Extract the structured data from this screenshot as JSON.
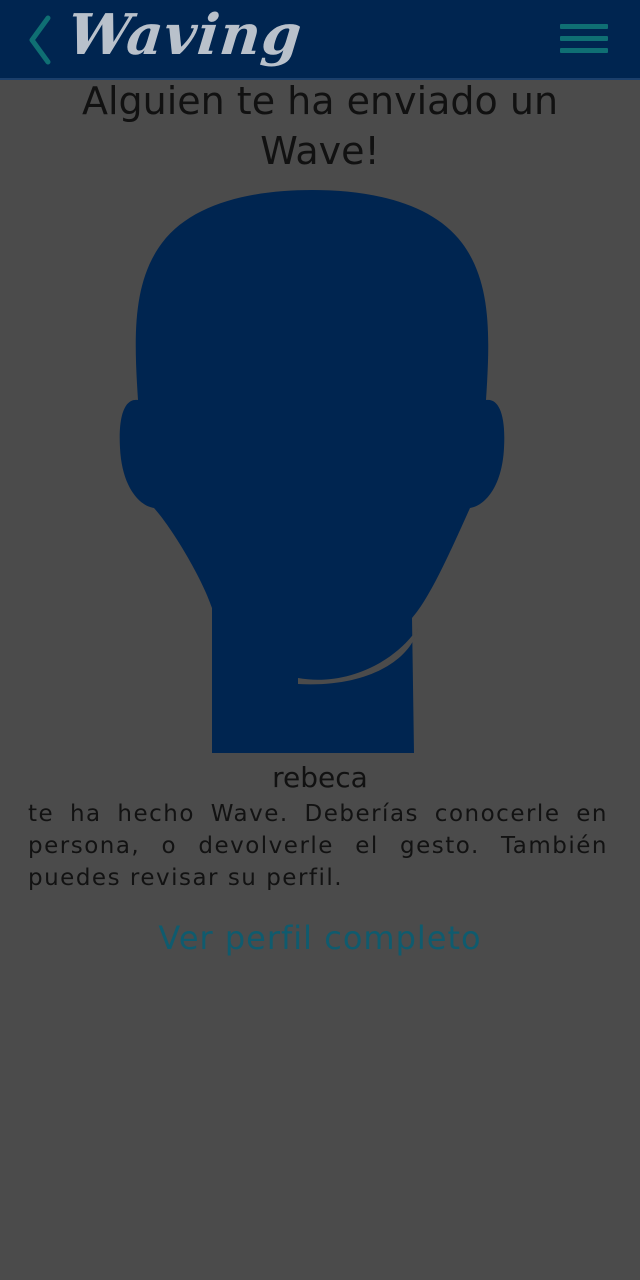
{
  "header": {
    "logo_text": "Waving",
    "back_icon": "chevron-left-icon",
    "menu_icon": "hamburger-menu-icon"
  },
  "main": {
    "headline": "Alguien te ha enviado un Wave!",
    "avatar_icon": "default-user-silhouette-icon",
    "username": "rebeca",
    "message": "te ha hecho Wave. Deberías conocerle en persona, o devolverle el gesto. También puedes revisar su perfil.",
    "profile_link_label": "Ver perfil completo"
  },
  "colors": {
    "header_background": "#002550",
    "page_background": "#4b4b4b",
    "accent_teal": "#0f6f73",
    "link_color": "#0f5b6e",
    "silhouette": "#002550"
  }
}
